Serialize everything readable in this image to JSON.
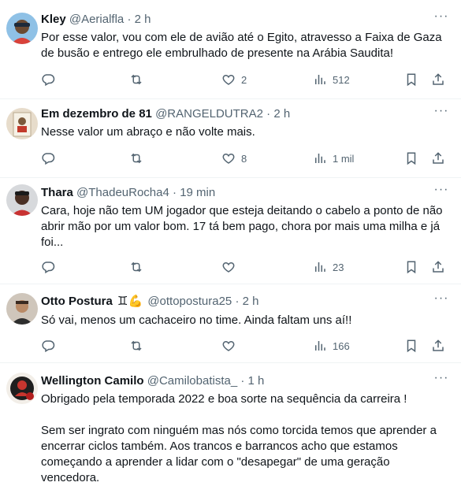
{
  "tweets": [
    {
      "name": "Kley",
      "handle": "@Aerialfla",
      "time": "2 h",
      "text": [
        "Por esse valor, vou com ele de avião até o Egito, atravesso a Faixa de Gaza de busão e entrego ele embrulhado de presente na Arábia Saudita!"
      ],
      "replies": "",
      "retweets": "",
      "likes": "2",
      "views": "512"
    },
    {
      "name": "Em dezembro de 81",
      "handle": "@RANGELDUTRA2",
      "time": "2 h",
      "text": [
        "Nesse valor um abraço e não volte mais."
      ],
      "replies": "",
      "retweets": "",
      "likes": "8",
      "views": "1 mil"
    },
    {
      "name": "Thara",
      "handle": "@ThadeuRocha4",
      "time": "19 min",
      "text": [
        "Cara, hoje não tem UM jogador que esteja deitando o cabelo a ponto de não abrir mão por um valor bom. 17 tá bem pago, chora por mais uma milha e já foi..."
      ],
      "replies": "",
      "retweets": "",
      "likes": "",
      "views": "23"
    },
    {
      "name": "Otto Postura",
      "name_emoji": "♊💪",
      "handle": "@ottopostura25",
      "time": "2 h",
      "text": [
        "Só vai, menos um cachaceiro no time. Ainda faltam uns aí!!"
      ],
      "replies": "",
      "retweets": "",
      "likes": "",
      "views": "166"
    },
    {
      "name": "Wellington Camilo",
      "handle": "@Camilobatista_",
      "time": "1 h",
      "text": [
        "Obrigado pela temporada 2022 e boa sorte na sequência da carreira !",
        "Sem ser ingrato com ninguém mas nós como torcida temos que aprender a encerrar ciclos também. Aos trancos e barrancos acho que estamos começando a aprender a lidar com o \"desapegar\" de uma geração vencedora."
      ]
    }
  ],
  "separator": "·",
  "more_glyph": "···",
  "colors": {
    "text": "#0f1419",
    "secondary": "#536471",
    "divider": "#eff3f4"
  },
  "icons": [
    "reply-icon",
    "retweet-icon",
    "like-icon",
    "views-icon",
    "bookmark-icon",
    "share-icon",
    "more-icon"
  ]
}
